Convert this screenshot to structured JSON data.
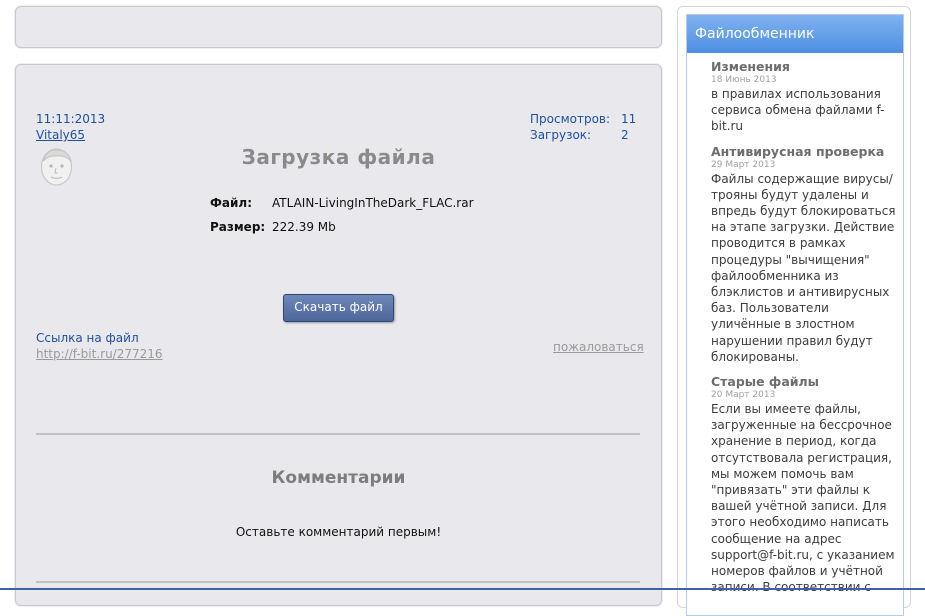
{
  "file_page": {
    "date": "11:11:2013",
    "author": "Vitaly65",
    "stats": {
      "views_label": "Просмотров:",
      "views_value": "11",
      "downloads_label": "Загрузок:",
      "downloads_value": "2"
    },
    "title": "Загрузка файла",
    "file_label": "Файл:",
    "file_name": "ATLAIN-LivingInTheDark_FLAC.rar",
    "size_label": "Размер:",
    "file_size": "222.39 Mb",
    "download_button": "Скачать файл",
    "file_link_label": "Ссылка на файл",
    "file_link_url": "http://f-bit.ru/277216",
    "complain_link": "пожаловаться",
    "comments_title": "Комментарии",
    "no_comments_text": "Оставьте комментарий первым!"
  },
  "sidebar": {
    "header": "Файлообменник",
    "news": [
      {
        "title": "Изменения",
        "date": "18 Июнь 2013",
        "text": "в правилах использования сервиса обмена файлами f-bit.ru"
      },
      {
        "title": "Антивирусная проверка",
        "date": "29 Март 2013",
        "text": "Файлы содержащие вирусы/трояны будут удалены и впредь будут блокироваться на этапе загрузки. Действие проводится в рамках процедуры \"вычищения\" файлообменника из блэклистов и антивирусных баз. Пользователи уличённые в злостном нарушении правил будут блокированы."
      },
      {
        "title": "Старые файлы",
        "date": "20 Март 2013",
        "text": "Если вы имеете файлы, загруженные на бессрочное хранение в период, когда отсутствовала регистрация, мы можем помочь вам \"привязать\" эти файлы к вашей учётной записи. Для этого необходимо написать сообщение на адрес support@f-bit.ru, с указанием номеров файлов и учётной записи. В соответствии с"
      }
    ]
  },
  "icons": {
    "avatar": "user-avatar-sketch-face"
  }
}
